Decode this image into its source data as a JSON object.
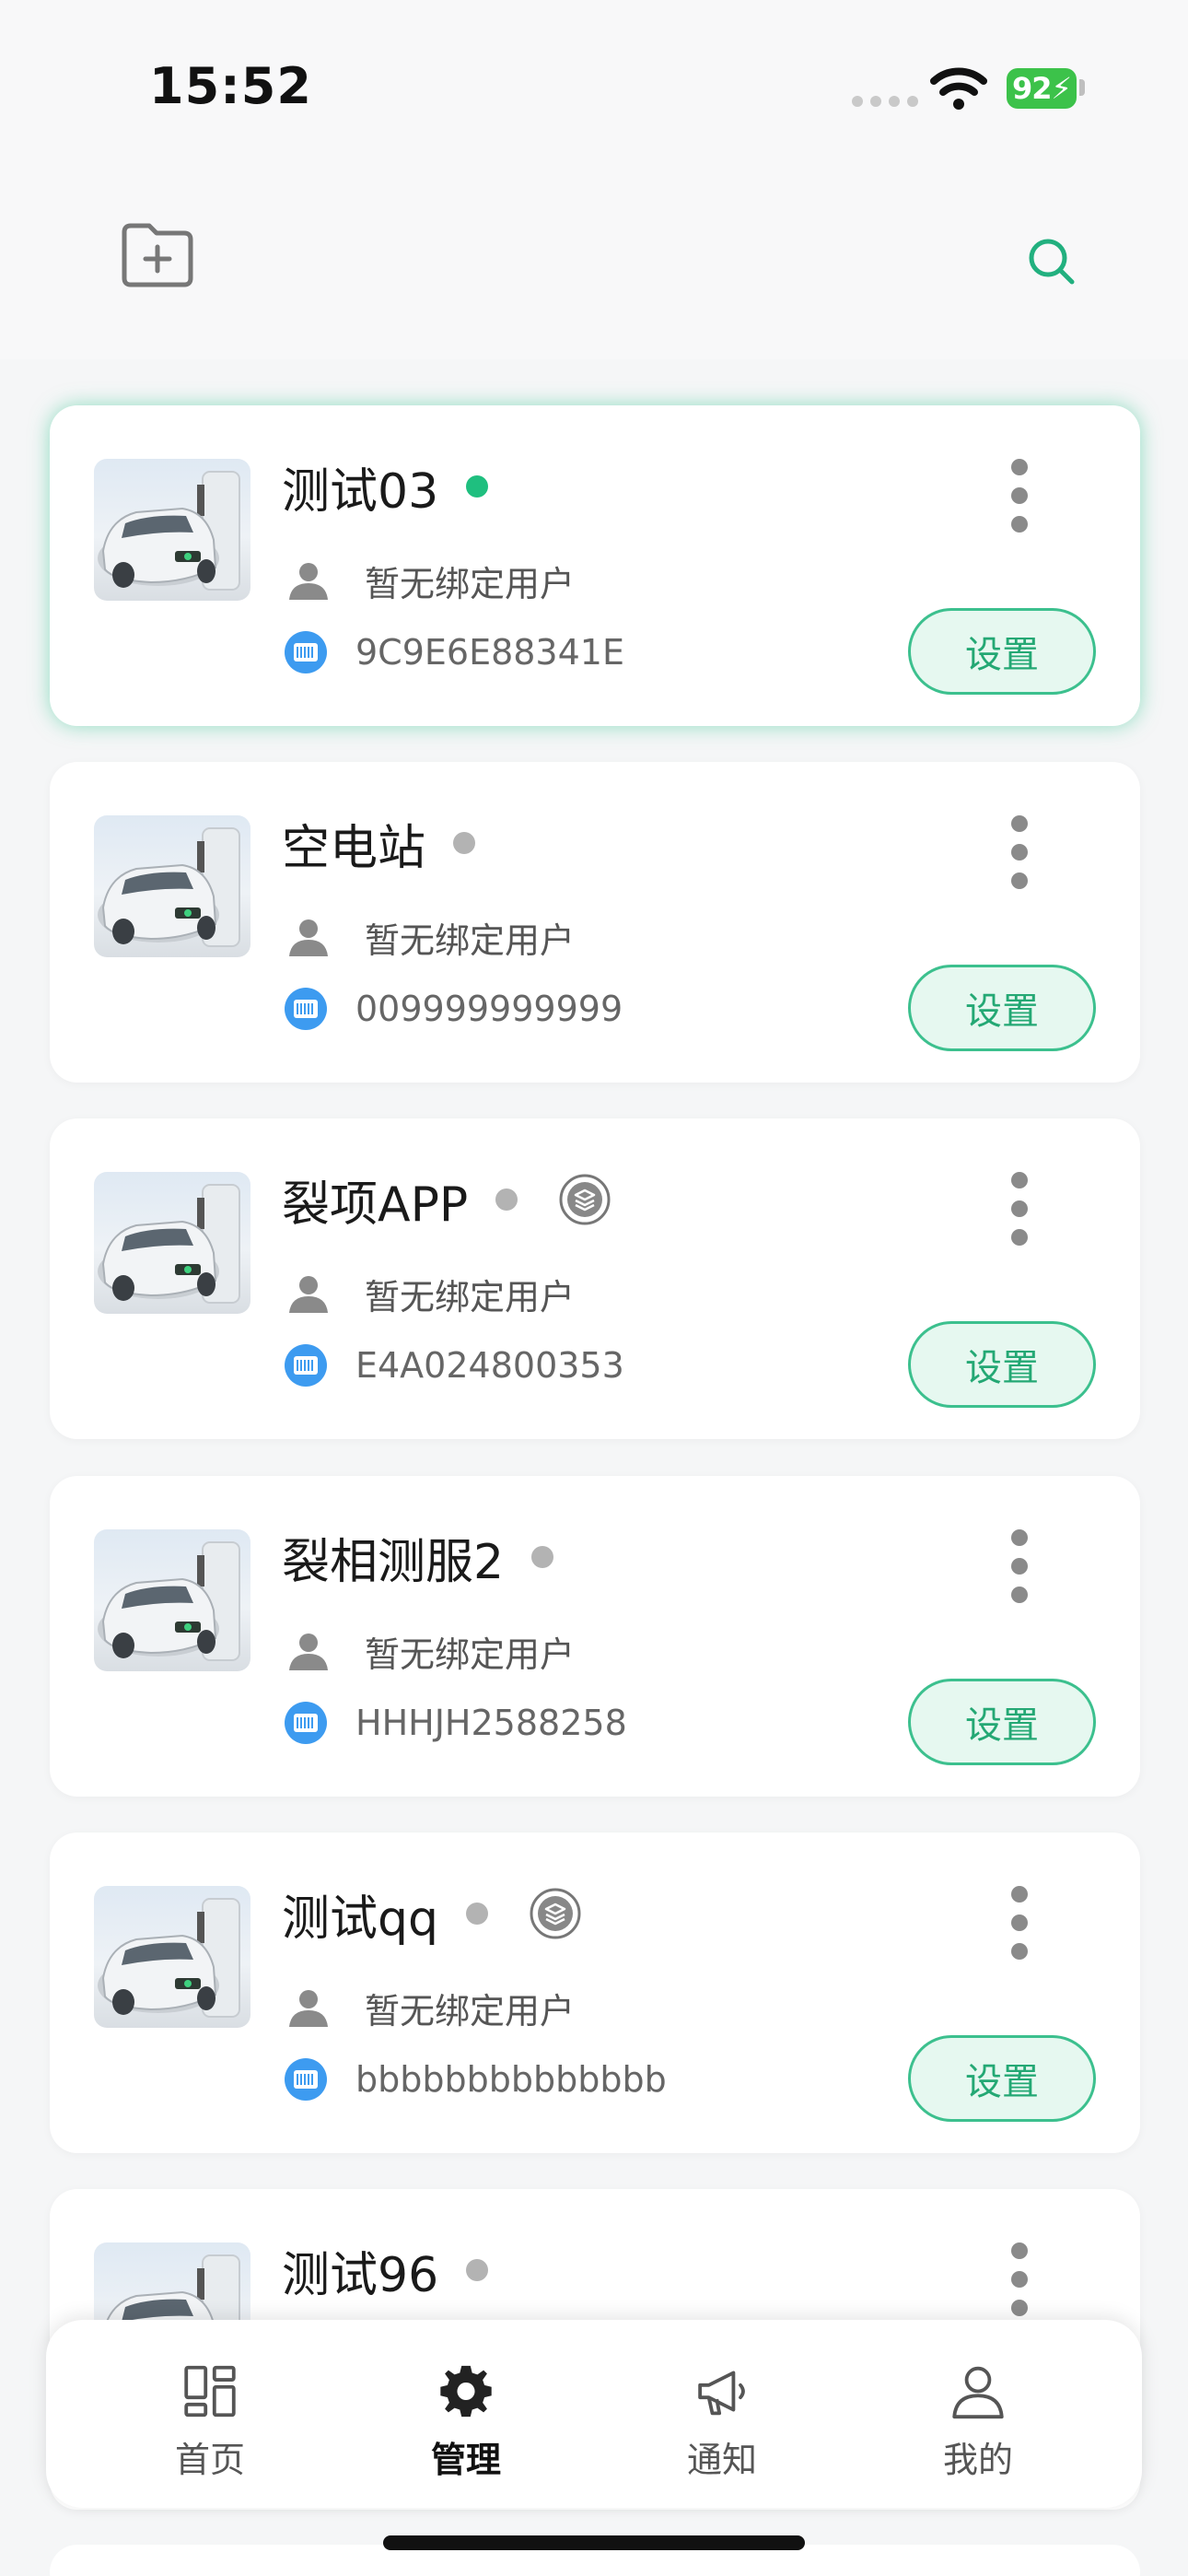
{
  "status_bar": {
    "time": "15:52",
    "battery": "92"
  },
  "devices": [
    {
      "name": "测试03",
      "online": true,
      "has_badge": false,
      "user_label": "暂无绑定用户",
      "sn": "9C9E6E88341E",
      "button": "设置",
      "active": true
    },
    {
      "name": "空电站",
      "online": false,
      "has_badge": false,
      "user_label": "暂无绑定用户",
      "sn": "009999999999",
      "button": "设置"
    },
    {
      "name": "裂项APP",
      "online": false,
      "has_badge": true,
      "user_label": "暂无绑定用户",
      "sn": "E4A024800353",
      "button": "设置"
    },
    {
      "name": "裂相测服2",
      "online": false,
      "has_badge": false,
      "user_label": "暂无绑定用户",
      "sn": "HHHJH2588258",
      "button": "设置"
    },
    {
      "name": "测试qq",
      "online": false,
      "has_badge": true,
      "user_label": "暂无绑定用户",
      "sn": "bbbbbbbbbbbbbb",
      "button": "设置"
    },
    {
      "name": "测试96",
      "online": false,
      "has_badge": false
    }
  ],
  "colors": {
    "online": "#1fbf7f",
    "offline": "#b3b3b3",
    "accent": "#24a874",
    "sn_icon": "#3d9bf0"
  },
  "tabs": [
    {
      "label": "首页",
      "icon": "dashboard-icon"
    },
    {
      "label": "管理",
      "icon": "gear-icon",
      "active": true
    },
    {
      "label": "通知",
      "icon": "megaphone-icon"
    },
    {
      "label": "我的",
      "icon": "profile-icon"
    }
  ]
}
